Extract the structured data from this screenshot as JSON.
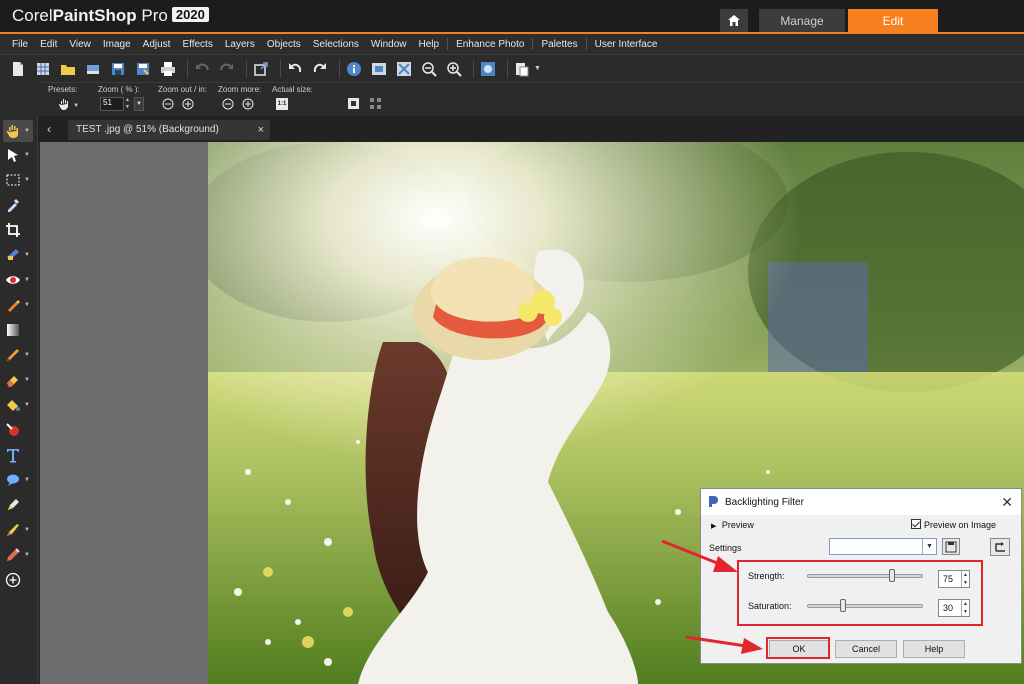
{
  "app": {
    "logo_corel": "Corel",
    "logo_paintshop": "PaintShop",
    "logo_pro": " Pro",
    "logo_version": "2020",
    "accent": "#f7801e"
  },
  "workspace_tabs": {
    "home_icon": "home-icon",
    "manage_label": "Manage",
    "edit_label": "Edit"
  },
  "menu": {
    "items": [
      "File",
      "Edit",
      "View",
      "Image",
      "Adjust",
      "Effects",
      "Layers",
      "Objects",
      "Selections",
      "Window",
      "Help",
      "Enhance Photo",
      "Palettes",
      "User Interface"
    ]
  },
  "tool_options": {
    "presets_label": "Presets:",
    "zoom_label": "Zoom ( % ):",
    "zoom_value": "51",
    "zoom_out_in_label": "Zoom out / in:",
    "zoom_more_label": "Zoom more:",
    "actual_size_label": "Actual size:"
  },
  "document": {
    "tab_label": "TEST .jpg @  51% (Background)"
  },
  "dialog": {
    "title": "Backlighting Filter",
    "preview_label": "Preview",
    "preview_on_image_label": "Preview on Image",
    "settings_label": "Settings",
    "strength_label": "Strength:",
    "strength_value": "75",
    "strength_level": 75,
    "saturation_label": "Saturation:",
    "saturation_value": "30",
    "saturation_level": 30,
    "ok_label": "OK",
    "cancel_label": "Cancel",
    "help_label": "Help"
  }
}
